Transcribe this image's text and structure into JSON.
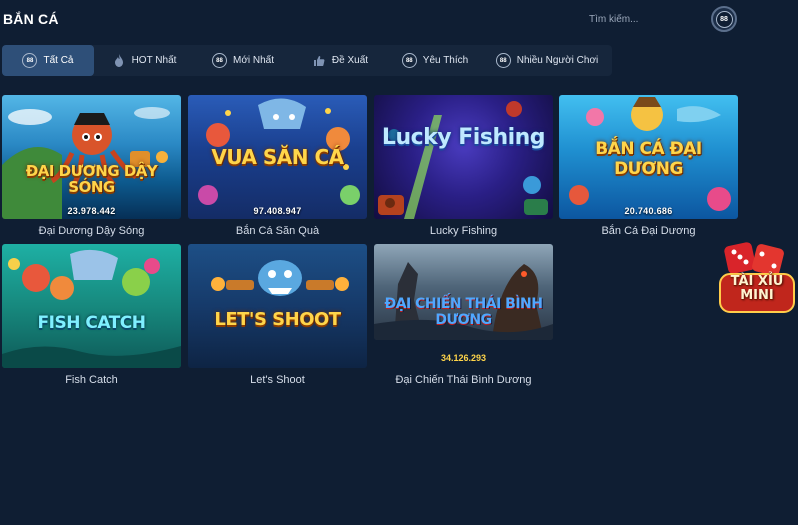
{
  "page": {
    "title": "BẮN CÁ"
  },
  "search": {
    "placeholder": "Tìm kiếm...",
    "logo_text": "88"
  },
  "tabs": [
    {
      "label": "Tất Cả",
      "icon": "logo-88-icon",
      "active": true
    },
    {
      "label": "HOT Nhất",
      "icon": "flame-icon",
      "active": false
    },
    {
      "label": "Mới Nhất",
      "icon": "logo-88-icon",
      "active": false
    },
    {
      "label": "Đề Xuất",
      "icon": "thumbs-up-icon",
      "active": false
    },
    {
      "label": "Yêu Thích",
      "icon": "logo-88-icon",
      "active": false
    },
    {
      "label": "Nhiều Người Chơi",
      "icon": "logo-88-icon",
      "active": false
    }
  ],
  "games": [
    {
      "name": "Đại Dương Dậy Sóng",
      "thumb_title": "ĐẠI DƯƠNG DẬY SÓNG",
      "jackpot": "23.978.442"
    },
    {
      "name": "Bắn Cá Săn Quà",
      "thumb_title": "VUA SĂN CÁ",
      "jackpot": "97.408.947"
    },
    {
      "name": "Lucky Fishing",
      "thumb_title": "Lucky Fishing",
      "jackpot": ""
    },
    {
      "name": "Bắn Cá Đại Dương",
      "thumb_title": "BẮN CÁ ĐẠI DƯƠNG",
      "jackpot": "20.740.686"
    },
    {
      "name": "Fish Catch",
      "thumb_title": "FISH CATCH",
      "jackpot": ""
    },
    {
      "name": "Let's Shoot",
      "thumb_title": "LET'S SHOOT",
      "jackpot": ""
    },
    {
      "name": "Đại Chiến Thái Bình Dương",
      "thumb_title": "ĐẠI CHIẾN THÁI BÌNH DƯƠNG",
      "jackpot": "34.126.293"
    }
  ],
  "floating": {
    "label": "TÀI XỈU MINI"
  },
  "colors": {
    "background": "#0f1e33",
    "tab_active": "#2e4f78",
    "jackpot_yellow": "#ffd54a"
  }
}
